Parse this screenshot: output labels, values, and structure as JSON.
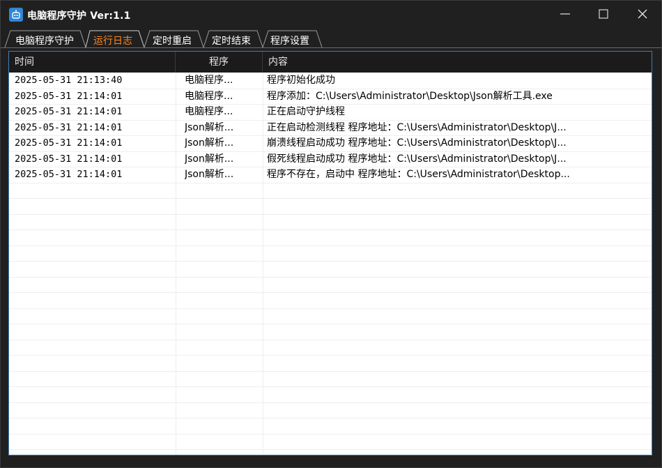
{
  "window": {
    "title": "电脑程序守护 Ver:1.1"
  },
  "tabs": [
    {
      "label": "电脑程序守护",
      "active": false
    },
    {
      "label": "运行日志",
      "active": true
    },
    {
      "label": "定时重启",
      "active": false
    },
    {
      "label": "定时结束",
      "active": false
    },
    {
      "label": "程序设置",
      "active": false
    }
  ],
  "log_table": {
    "columns": [
      "时间",
      "程序",
      "内容"
    ],
    "rows": [
      {
        "time": "2025-05-31 21:13:40",
        "program": "电脑程序...",
        "content": "程序初始化成功"
      },
      {
        "time": "2025-05-31 21:14:01",
        "program": "电脑程序...",
        "content": "程序添加：C:\\Users\\Administrator\\Desktop\\Json解析工具.exe"
      },
      {
        "time": "2025-05-31 21:14:01",
        "program": "电脑程序...",
        "content": "正在启动守护线程"
      },
      {
        "time": "2025-05-31 21:14:01",
        "program": "Json解析...",
        "content": "正在启动检测线程 程序地址：C:\\Users\\Administrator\\Desktop\\J..."
      },
      {
        "time": "2025-05-31 21:14:01",
        "program": "Json解析...",
        "content": "崩溃线程启动成功 程序地址：C:\\Users\\Administrator\\Desktop\\J..."
      },
      {
        "time": "2025-05-31 21:14:01",
        "program": "Json解析...",
        "content": "假死线程启动成功 程序地址：C:\\Users\\Administrator\\Desktop\\J..."
      },
      {
        "time": "2025-05-31 21:14:01",
        "program": "Json解析...",
        "content": "程序不存在，启动中 程序地址：C:\\Users\\Administrator\\Desktop..."
      }
    ]
  },
  "colors": {
    "accent_tab": "#ff8a1f",
    "table_border": "#3f7fb8",
    "app_icon": "#2f86d6"
  },
  "icons": {
    "app": "robot-icon",
    "minimize": "minimize-icon",
    "maximize": "maximize-icon",
    "close": "close-icon"
  }
}
